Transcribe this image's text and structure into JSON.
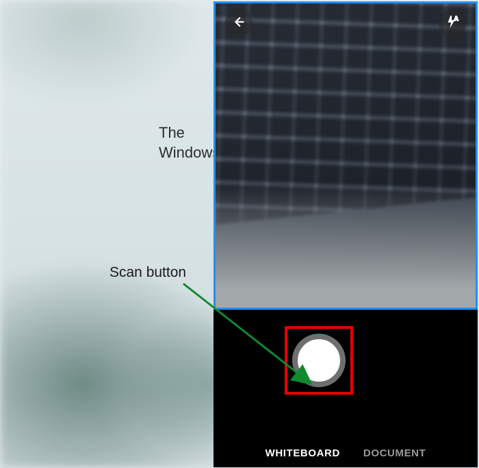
{
  "watermark": {
    "line1": "The",
    "line2": "WindowsClub"
  },
  "annotation": {
    "label": "Scan button"
  },
  "camera": {
    "modes": {
      "whiteboard": "WHITEBOARD",
      "document": "DOCUMENT"
    },
    "active_mode": "whiteboard",
    "icons": {
      "back": "back-arrow-icon",
      "flash": "flash-auto-icon"
    }
  },
  "colors": {
    "viewfinder_border": "#1e90ff",
    "highlight_box": "#e60000",
    "arrow": "#0f8a2f"
  }
}
